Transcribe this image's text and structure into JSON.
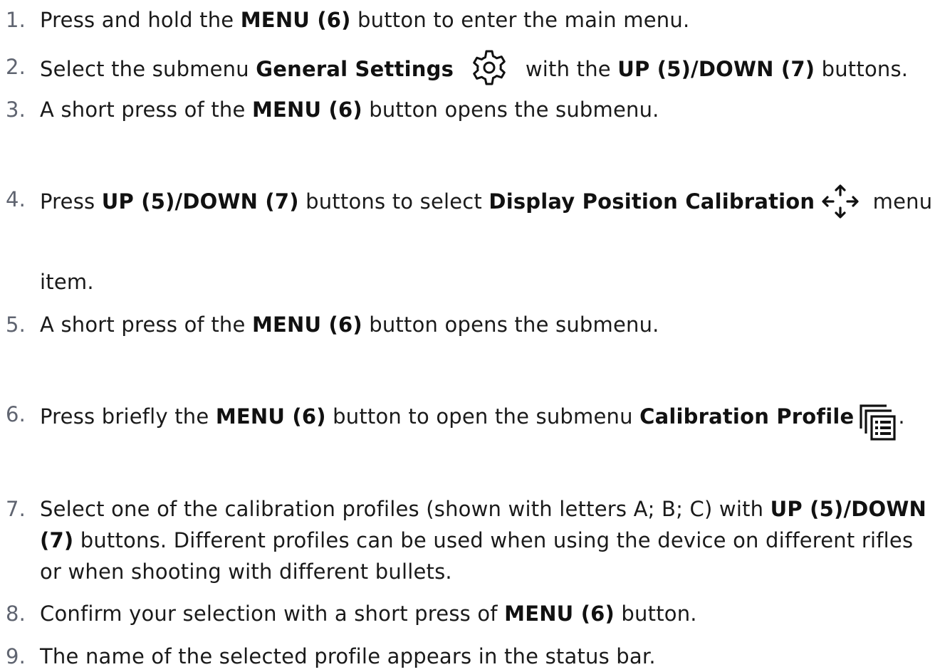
{
  "steps": [
    {
      "num": "1.",
      "parts": [
        "Press and hold the ",
        "MENU (6)",
        " button to enter the main menu."
      ]
    },
    {
      "num": "2.",
      "parts": [
        "Select the submenu ",
        "General Settings",
        " ",
        " with the ",
        "UP (5)/DOWN (7)",
        " buttons."
      ],
      "icon": "gear-icon"
    },
    {
      "num": "3.",
      "parts": [
        "A short press of the ",
        "MENU (6)",
        " button opens the submenu."
      ]
    },
    {
      "num": "4.",
      "parts": [
        "Press ",
        "UP (5)/DOWN (7)",
        " buttons to select ",
        "Display Position Calibration",
        " menu"
      ],
      "continuation": "item.",
      "icon": "move-arrows-icon"
    },
    {
      "num": "5.",
      "parts": [
        "A short press of the ",
        "MENU (6)",
        " button opens the submenu."
      ]
    },
    {
      "num": "6.",
      "parts": [
        "Press briefly the ",
        "MENU (6)",
        " button to open the submenu ",
        "Calibration Profile",
        "."
      ],
      "icon": "calibration-profile-icon"
    },
    {
      "num": "7.",
      "lines": [
        [
          "Select one of the calibration profiles (shown with letters A; B; C) with ",
          "UP (5)/DOWN"
        ],
        [
          "(7)",
          " buttons. Different profiles can be used when using the device on different rifles"
        ],
        [
          "or when shooting with different bullets."
        ]
      ]
    },
    {
      "num": "8.",
      "parts": [
        "Confirm your selection with a short press of ",
        "MENU (6)",
        " button."
      ]
    },
    {
      "num": "9.",
      "parts": [
        "The name of the selected profile appears in the status bar."
      ]
    }
  ]
}
